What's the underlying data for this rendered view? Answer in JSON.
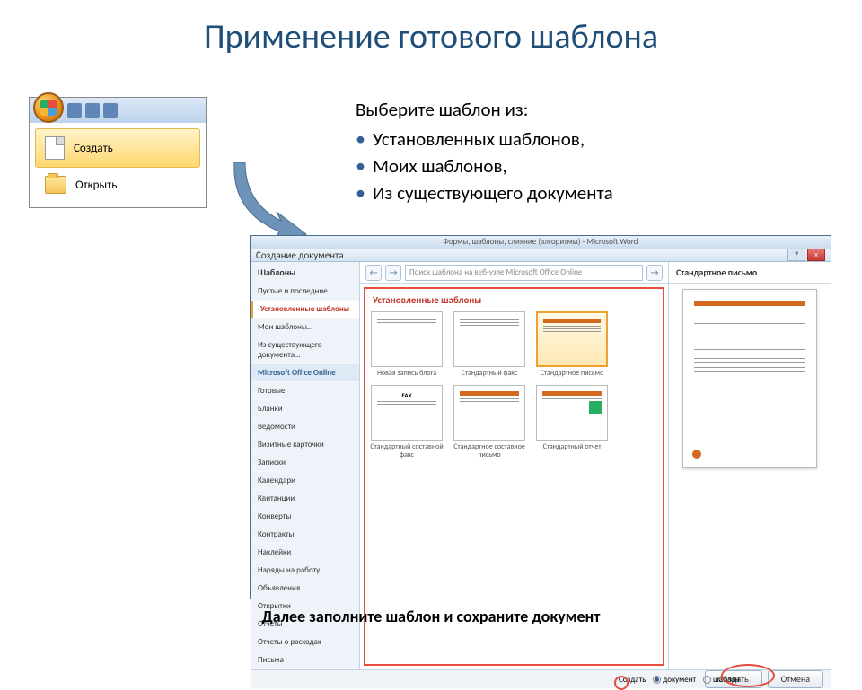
{
  "slide": {
    "title": "Применение готового шаблона",
    "bottom_text": "Далее заполните шаблон и сохраните документ"
  },
  "office_menu": {
    "create": "Создать",
    "open": "Открыть"
  },
  "bullets": {
    "intro": "Выберите шаблон из:",
    "items": [
      "Установленных шаблонов,",
      "Моих шаблонов,",
      "Из существующего документа"
    ]
  },
  "dialog": {
    "word_title": "Формы, шаблоны, слияние (алгоритмы) - Microsoft Word",
    "title": "Создание документа",
    "search_placeholder": "Поиск шаблона на веб-узле Microsoft Office Online",
    "left_header": "Шаблоны",
    "left_items": [
      "Пустые и последние",
      "Установленные шаблоны",
      "Мои шаблоны…",
      "Из существующего документа…",
      "Microsoft Office Online",
      "Готовые",
      "Бланки",
      "Ведомости",
      "Визитные карточки",
      "Записки",
      "Календари",
      "Квитанции",
      "Конверты",
      "Контракты",
      "Наклейки",
      "Наряды на работу",
      "Объявления",
      "Открытки",
      "Отчеты",
      "Отчеты о расходах",
      "Письма"
    ],
    "mid_header": "Установленные шаблоны",
    "thumbs": [
      "Новая запись блога",
      "Стандартный факс",
      "Стандартное письмо",
      "Стандартный составной факс",
      "Стандартное составное письмо",
      "Стандартный отчет"
    ],
    "preview_title": "Стандартное письмо",
    "radio_doc": "документ",
    "radio_tpl": "шаблон",
    "radio_label": "Создать",
    "btn_create": "Создать",
    "btn_cancel": "Отмена"
  }
}
